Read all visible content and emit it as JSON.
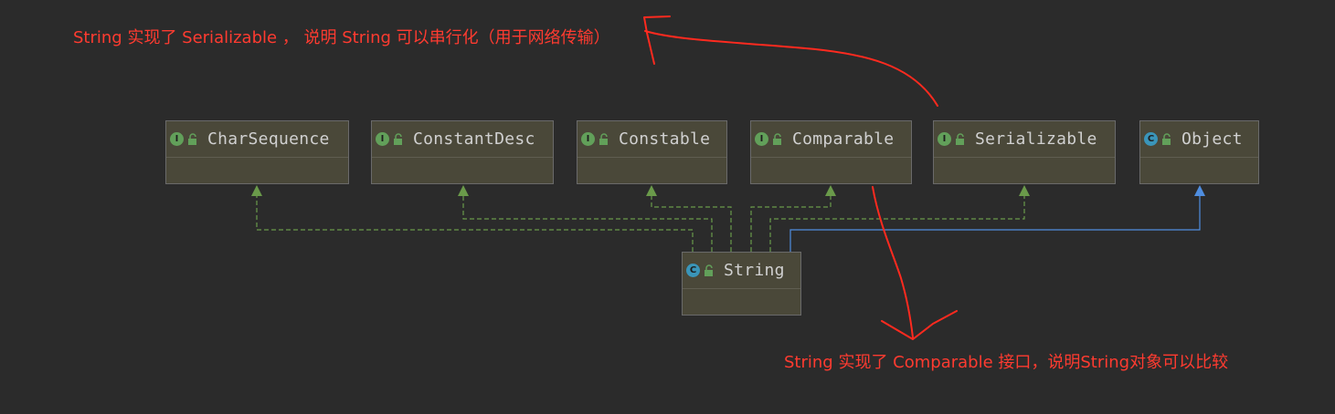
{
  "colors": {
    "background": "#2b2b2b",
    "node_fill": "#4a4839",
    "implements_line": "#6a9a4a",
    "extends_line": "#4f8ee0",
    "annotation": "#ff3b30"
  },
  "nodes": [
    {
      "id": "charsequence",
      "name": "CharSequence",
      "kind": "interface",
      "icon_letter": "I",
      "icon": "interface-icon"
    },
    {
      "id": "constantdesc",
      "name": "ConstantDesc",
      "kind": "interface",
      "icon_letter": "I",
      "icon": "interface-icon"
    },
    {
      "id": "constable",
      "name": "Constable",
      "kind": "interface",
      "icon_letter": "I",
      "icon": "interface-icon"
    },
    {
      "id": "comparable",
      "name": "Comparable",
      "kind": "interface",
      "icon_letter": "I",
      "icon": "interface-icon"
    },
    {
      "id": "serializable",
      "name": "Serializable",
      "kind": "interface",
      "icon_letter": "I",
      "icon": "interface-icon"
    },
    {
      "id": "object",
      "name": "Object",
      "kind": "class",
      "icon_letter": "C",
      "icon": "class-icon"
    },
    {
      "id": "string",
      "name": "String",
      "kind": "class",
      "icon_letter": "C",
      "icon": "class-icon"
    }
  ],
  "annotations": {
    "serializable_note": "String 实现了 Serializable ， 说明 String 可以串行化（用于网络传输）",
    "comparable_note": "String 实现了 Comparable 接口，说明String对象可以比较"
  }
}
